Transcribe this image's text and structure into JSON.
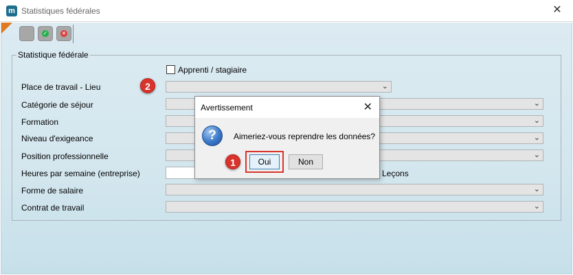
{
  "window": {
    "title": "Statistiques fédérales",
    "app_icon_glyph": "m",
    "close_glyph": "✕"
  },
  "toolbar": {
    "buttons": [
      {
        "name": "blank-button",
        "color": "#a7a7a7"
      },
      {
        "name": "confirm-button",
        "icon": "check-icon",
        "color": "#22b14c"
      },
      {
        "name": "cancel-button",
        "icon": "cross-icon",
        "color": "#e03c3c"
      }
    ]
  },
  "form": {
    "legend": "Statistique fédérale",
    "apprenti_label": "Apprenti / stagiaire",
    "place_label": "Place de travail - Lieu",
    "categorie_label": "Catégorie de séjour",
    "formation_label": "Formation",
    "niveau_label": "Niveau d'exigeance",
    "position_label": "Position professionnelle",
    "heures_label": "Heures par semaine (entreprise)",
    "lecons_label": "Leçons",
    "salaire_label": "Forme de salaire",
    "contrat_label": "Contrat de travail",
    "dropdown_arrow": "⌄"
  },
  "annotations": {
    "badge_1": "1",
    "badge_2": "2",
    "badge_color": "#d8342c"
  },
  "dialog": {
    "title": "Avertissement",
    "close_glyph": "✕",
    "icon_glyph": "?",
    "message": "Aimeriez-vous reprendre les données?",
    "yes_label": "Oui",
    "no_label": "Non"
  }
}
